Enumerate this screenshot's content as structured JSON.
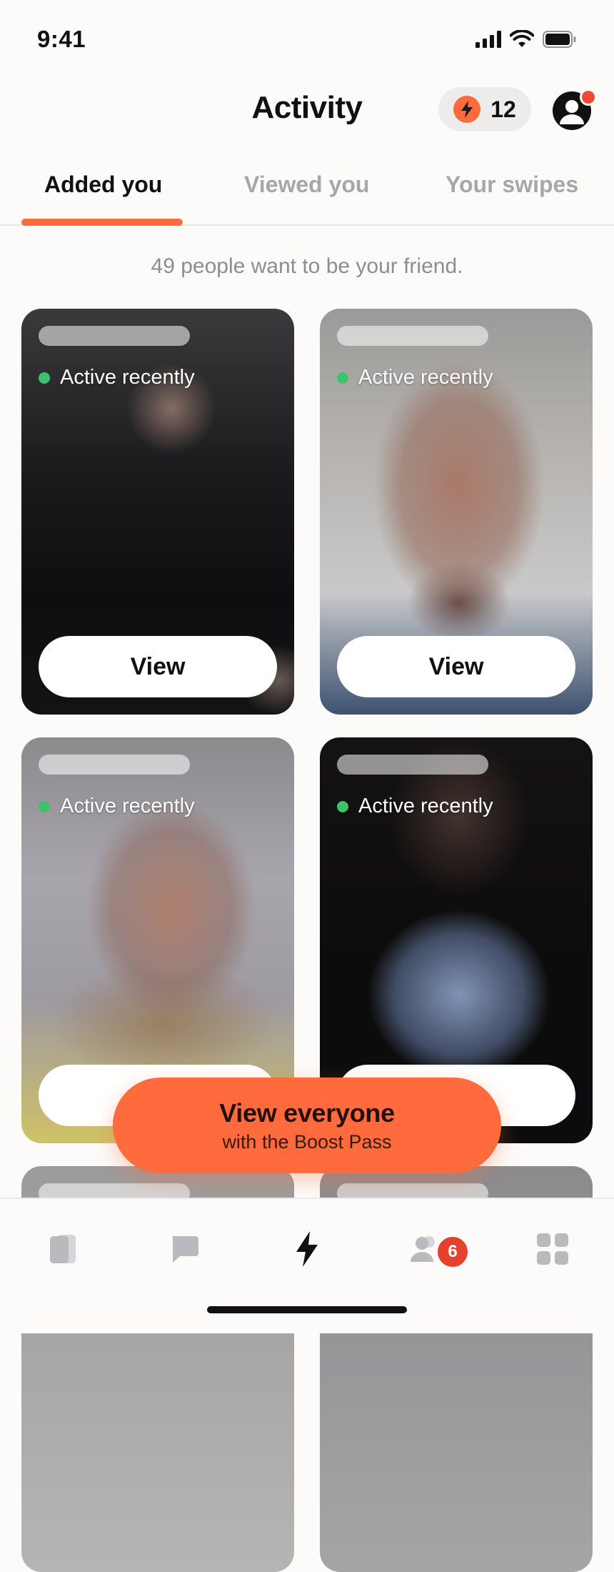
{
  "status_bar": {
    "time": "9:41"
  },
  "header": {
    "title": "Activity",
    "boost_count": "12"
  },
  "tabs": [
    {
      "label": "Added you",
      "active": true
    },
    {
      "label": "Viewed you",
      "active": false
    },
    {
      "label": "Your swipes",
      "active": false
    }
  ],
  "subtitle": "49 people want to be your friend.",
  "cards": [
    {
      "status": "Active recently",
      "button": "View"
    },
    {
      "status": "Active recently",
      "button": "View"
    },
    {
      "status": "Active recently",
      "button": ""
    },
    {
      "status": "Active recently",
      "button": ""
    }
  ],
  "cta": {
    "title": "View everyone",
    "subtitle": "with the Boost Pass"
  },
  "bottom_nav": {
    "items": [
      "cards-icon",
      "chat-icon",
      "bolt-icon",
      "friends-icon",
      "grid-icon"
    ],
    "friends_badge": "6"
  },
  "colors": {
    "accent": "#FF6B3D",
    "online": "#3DC26B",
    "badge": "#E5412E"
  }
}
